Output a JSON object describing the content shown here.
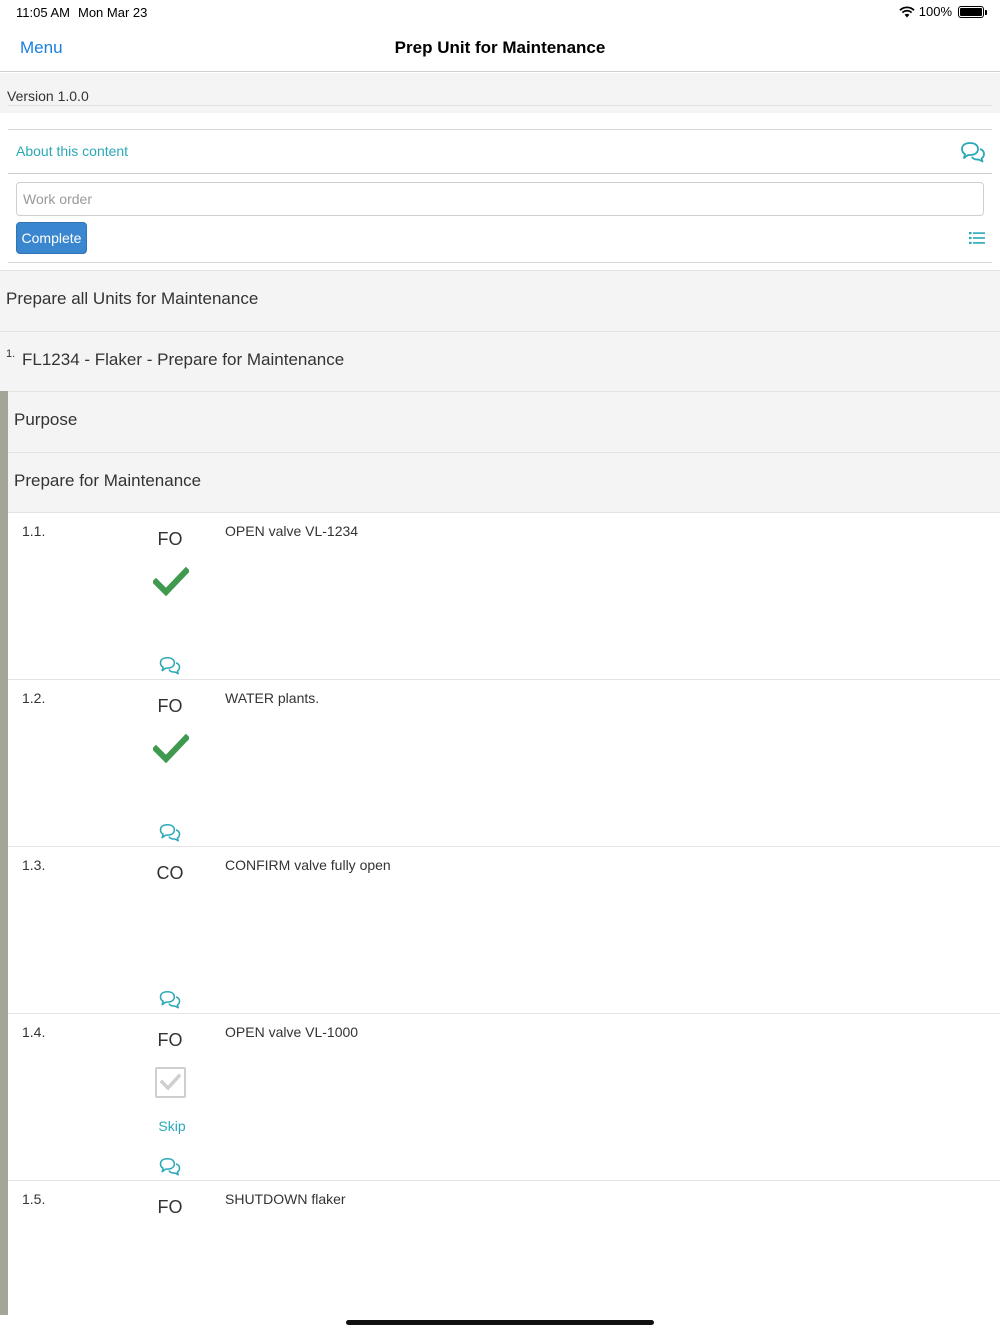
{
  "status_bar": {
    "time": "11:05 AM",
    "date": "Mon Mar 23",
    "battery": "100%"
  },
  "nav": {
    "menu_label": "Menu",
    "title": "Prep Unit for Maintenance"
  },
  "version": "Version 1.0.0",
  "about": {
    "link_label": "About this content",
    "icon": "comments-icon"
  },
  "work_order": {
    "placeholder": "Work order",
    "value": ""
  },
  "complete_label": "Complete",
  "sections": {
    "main": "Prepare all Units for Maintenance",
    "unit_number": "1.",
    "unit_title": "FL1234 - Flaker - Prepare for Maintenance",
    "purpose": "Purpose",
    "prepare": "Prepare for Maintenance"
  },
  "steps": [
    {
      "num": "1.1.",
      "code": "FO",
      "desc": "OPEN valve VL-1234",
      "state": "checked"
    },
    {
      "num": "1.2.",
      "code": "FO",
      "desc": "WATER plants.",
      "state": "checked"
    },
    {
      "num": "1.3.",
      "code": "CO",
      "desc": "CONFIRM valve fully open",
      "state": "none"
    },
    {
      "num": "1.4.",
      "code": "FO",
      "desc": "OPEN valve VL-1000",
      "state": "checkbox",
      "skip_label": "Skip"
    },
    {
      "num": "1.5.",
      "code": "FO",
      "desc": "SHUTDOWN flaker",
      "state": "none"
    }
  ],
  "colors": {
    "accent": "#2aa8b8",
    "check": "#3f9a4f",
    "button": "#3a87cf",
    "nav_link": "#1a7fe0"
  }
}
